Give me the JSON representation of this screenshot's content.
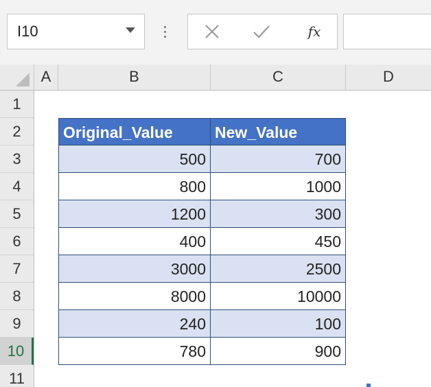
{
  "formula_bar": {
    "name_box": "I10",
    "fx_label": "fx",
    "formula_value": ""
  },
  "columns": [
    "A",
    "B",
    "C",
    "D"
  ],
  "rows": [
    "1",
    "2",
    "3",
    "4",
    "5",
    "6",
    "7",
    "8",
    "9",
    "10",
    "11"
  ],
  "active_row": "10",
  "table": {
    "headers": [
      "Original_Value",
      "New_Value"
    ],
    "rows": [
      [
        "500",
        "700"
      ],
      [
        "800",
        "1000"
      ],
      [
        "1200",
        "300"
      ],
      [
        "400",
        "450"
      ],
      [
        "3000",
        "2500"
      ],
      [
        "8000",
        "10000"
      ],
      [
        "240",
        "100"
      ],
      [
        "780",
        "900"
      ]
    ]
  },
  "colors": {
    "header_fill": "#4472c4",
    "band_fill": "#d9e1f2",
    "active_accent": "#217346"
  },
  "icons": [
    "dropdown-arrow-icon",
    "more-options-icon",
    "cancel-icon",
    "enter-check-icon",
    "insert-function-icon",
    "select-all-icon"
  ]
}
